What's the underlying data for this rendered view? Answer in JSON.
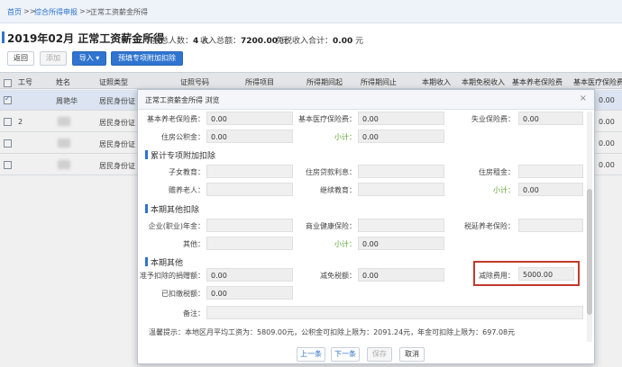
{
  "breadcrumb": {
    "home": "首页",
    "sep1": ">>",
    "module": "综合所得申报",
    "sep2": ">>",
    "current": "正常工资薪金所得"
  },
  "page": {
    "title": "2019年02月  正常工资薪金所得",
    "count_label": "申报总人数：",
    "count_value": "4",
    "count_unit": "人",
    "income_label": "收入总额：",
    "income_value": "7200.00",
    "income_unit": "元",
    "exempt_label": "免税收入合计：",
    "exempt_value": "0.00",
    "exempt_unit": "元"
  },
  "toolbar": {
    "back": "返回",
    "add": "添加",
    "import": "导入",
    "import_caret": "▾",
    "prefill": "预填专项附加扣除"
  },
  "grid": {
    "headers": [
      "工号",
      "姓名",
      "证照类型",
      "证照号码",
      "所得项目",
      "所得期间起",
      "所得期间止",
      "本期收入",
      "本期免税收入",
      "基本养老保险费",
      "基本医疗保险费"
    ],
    "rows": [
      {
        "no": "",
        "name": "周艳华",
        "idtype": "居民身份证",
        "pension": "0.00"
      },
      {
        "no": "2",
        "name": "",
        "idtype": "居民身份证",
        "pension": "0.00"
      },
      {
        "no": "",
        "name": "",
        "idtype": "居民身份证",
        "pension": "0.00"
      },
      {
        "no": "",
        "name": "",
        "idtype": "居民身份证",
        "pension": "0.00"
      }
    ]
  },
  "modal": {
    "title": "正常工资薪金所得 浏览",
    "close": "×",
    "row1": {
      "pension_label": "基本养老保险费：",
      "pension_value": "0.00",
      "medical_label": "基本医疗保险费：",
      "medical_value": "0.00",
      "unemp_label": "失业保险费：",
      "unemp_value": "0.00"
    },
    "row2": {
      "housing_label": "住房公积金：",
      "housing_value": "0.00",
      "subtotal_label": "小计：",
      "subtotal_value": "0.00"
    },
    "sec_special": "累计专项附加扣除",
    "special": {
      "child_label": "子女教育：",
      "child_value": "",
      "loan_label": "住房贷款利息：",
      "loan_value": "",
      "rent_label": "住房租金：",
      "rent_value": "",
      "elder_label": "赡养老人：",
      "elder_value": "",
      "cont_label": "继续教育：",
      "cont_value": "",
      "subtotal_label": "小计：",
      "subtotal_value": "0.00"
    },
    "sec_other": "本期其他扣除",
    "other": {
      "annuity_label": "企业(职业)年金：",
      "annuity_value": "",
      "health_label": "商业健康保险：",
      "health_value": "",
      "taxpension_label": "税延养老保险：",
      "taxpension_value": "",
      "misc_label": "其他：",
      "misc_value": "",
      "subtotal_label": "小计：",
      "subtotal_value": "0.00"
    },
    "sec_more": "本期其他",
    "more": {
      "donation_label": "准予扣除的捐赠额：",
      "donation_value": "0.00",
      "reduce_label": "减免税额：",
      "reduce_value": "0.00",
      "deduct_label": "减除费用：",
      "deduct_value": "5000.00",
      "prepaid_label": "已扣缴税额：",
      "prepaid_value": "0.00",
      "remark_label": "备注：",
      "remark_value": ""
    },
    "tip": "温馨提示：本地区月平均工资为：5809.00元，公积金可扣除上限为：2091.24元，年金可扣除上限为：697.08元",
    "buttons": {
      "prev": "上一条",
      "next": "下一条",
      "save": "保存",
      "cancel": "取消"
    }
  },
  "colors": {
    "accent": "#2f74d0",
    "highlight": "#c0392b",
    "subtotal": "#5aa02c"
  }
}
